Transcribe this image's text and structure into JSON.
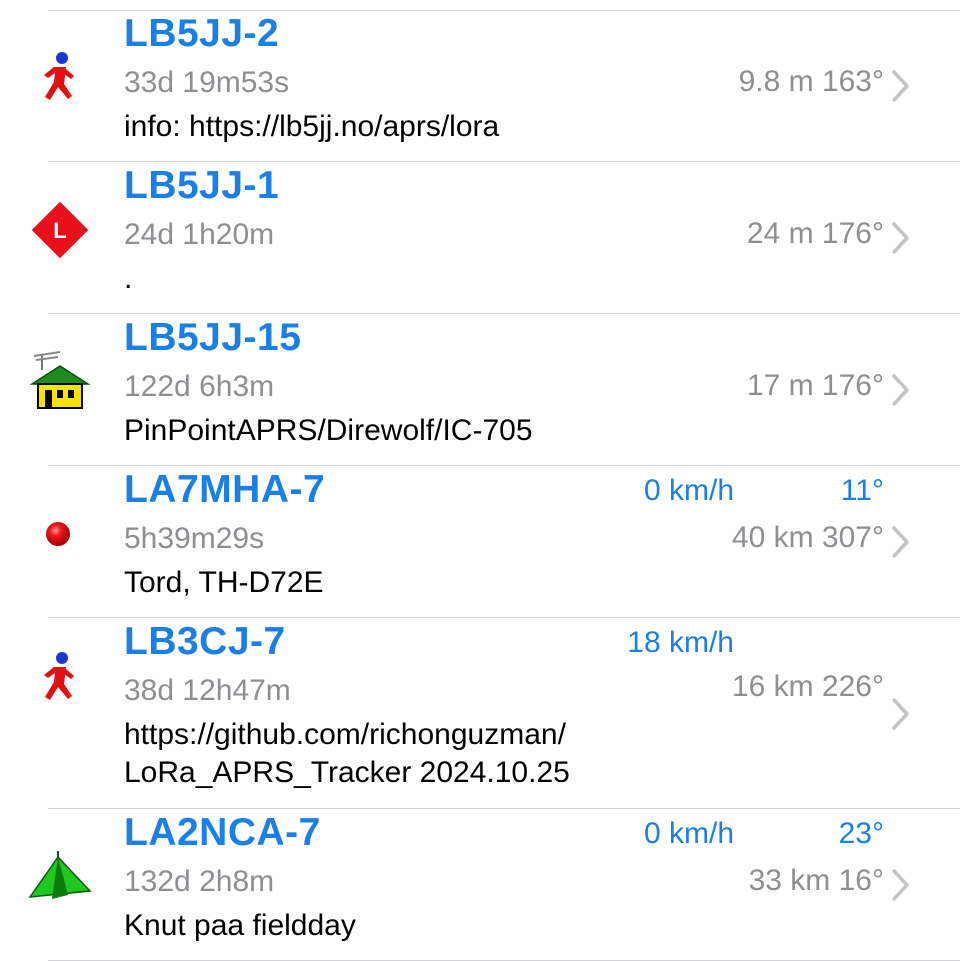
{
  "stations": [
    {
      "callsign": "LB5JJ-2",
      "age": "33d 19m53s",
      "distance_bearing": "9.8 m 163°",
      "comment_lines": [
        "info: https://lb5jj.no/aprs/lora"
      ],
      "speed": "",
      "course": "",
      "icon": "runner-icon"
    },
    {
      "callsign": "LB5JJ-1",
      "age": "24d 1h20m",
      "distance_bearing": "24 m 176°",
      "comment_lines": [
        "."
      ],
      "speed": "",
      "course": "",
      "icon": "lora-diamond-icon",
      "icon_letter": "L"
    },
    {
      "callsign": "LB5JJ-15",
      "age": "122d 6h3m",
      "distance_bearing": "17 m 176°",
      "comment_lines": [
        "PinPointAPRS/Direwolf/IC-705"
      ],
      "speed": "",
      "course": "",
      "icon": "house-antenna-icon"
    },
    {
      "callsign": "LA7MHA-7",
      "age": "5h39m29s",
      "distance_bearing": "40 km 307°",
      "comment_lines": [
        "Tord, TH-D72E"
      ],
      "speed": "0 km/h",
      "course": "11°",
      "icon": "red-dot-icon"
    },
    {
      "callsign": "LB3CJ-7",
      "age": "38d 12h47m",
      "distance_bearing": "16 km 226°",
      "comment_lines": [
        "https://github.com/richonguzman/",
        "LoRa_APRS_Tracker 2024.10.25"
      ],
      "speed": "18 km/h",
      "course": "",
      "icon": "runner-icon"
    },
    {
      "callsign": "LA2NCA-7",
      "age": "132d 2h8m",
      "distance_bearing": "33 km 16°",
      "comment_lines": [
        "Knut paa fieldday"
      ],
      "speed": "0 km/h",
      "course": "23°",
      "icon": "tent-icon"
    }
  ],
  "colors": {
    "accent": "#1b7fe8",
    "secondary_text": "#8e8e93",
    "separator": "#d3d3d6"
  }
}
